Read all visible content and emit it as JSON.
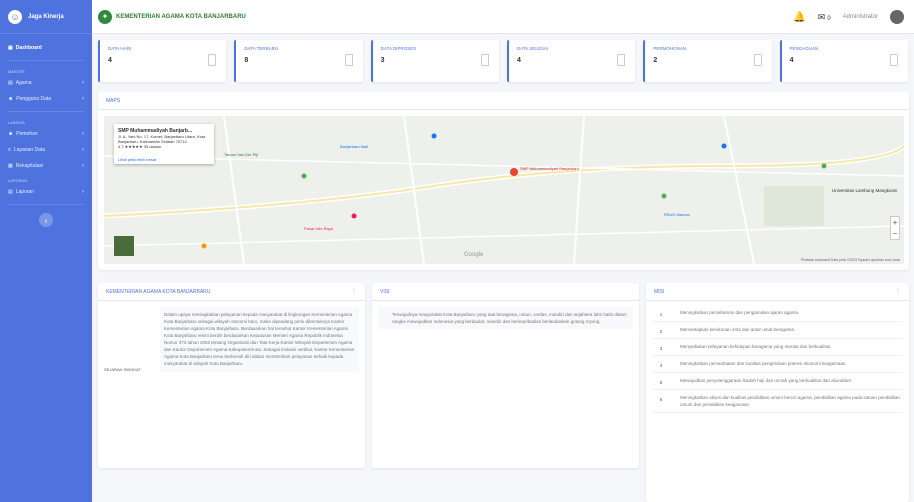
{
  "sidebar": {
    "brand": "Jaga Kinerja",
    "dashboard": "Dashboard",
    "head1": "Master",
    "item_agama": "Agama",
    "item_pengguna": "Pengguna Data",
    "head2": "Lainnya",
    "item_pemohon": "Pemohon",
    "item_layanan": "Layanan Data",
    "item_rekap": "Rekapitulasi",
    "head3": "Laporan",
    "item_laporan": "Laporan"
  },
  "topbar": {
    "title": "KEMENTERIAN AGAMA KOTA BANJARBARU",
    "mail_count": "0",
    "user": "Administrator"
  },
  "cards": [
    {
      "label": "DATA HARI",
      "value": "4"
    },
    {
      "label": "DATA TERBARU",
      "value": "8"
    },
    {
      "label": "DATA DIPROSES",
      "value": "3"
    },
    {
      "label": "DATA SELESAI",
      "value": "4"
    },
    {
      "label": "PERMOHONAN",
      "value": "2"
    },
    {
      "label": "PENGADUAN",
      "value": "4"
    }
  ],
  "map": {
    "heading": "MAPS",
    "info_name": "SMP Muhammadiyah Banjarb...",
    "info_addr": "Jl. A. Yani No. 17, Komet, Banjarbaru Utara, Kota Banjarbaru, Kalimantan Selatan 70714",
    "info_rating": "4.7 ★★★★★ 35 ulasan",
    "info_link": "Lihat peta lebih besar",
    "footer": "Pintasan keyboard  Data peta ©2023  Syarat  Laporkan error peta",
    "google": "Google",
    "places": [
      {
        "label": "SMP Muhammadiyah Banjarbaru"
      },
      {
        "label": "Banjarbaru Mall"
      },
      {
        "label": "Universitas Lambung Mangkurat"
      },
      {
        "label": "Taman Van Der Pijl"
      },
      {
        "label": "RSUD Idaman"
      },
      {
        "label": "Pasar Ulin Raya"
      }
    ]
  },
  "profil": {
    "heading": "KEMENTERIAN AGAMA KOTA BANJARBARU",
    "label": "SEJARAH SINGKAT",
    "text": "Dalam upaya meningkatkan pelayanan kepada masyarakat di lingkungan Kementerian Agama Kota Banjarbaru sebagai wilayah otonomi baru, maka dipandang perlu dibentuknya Kantor Kementerian Agama Kota Banjarbaru. Berdasarkan hal tersebut Kantor Kementerian Agama Kota Banjarbaru resmi berdiri berdasarkan Keputusan Menteri Agama Republik Indonesia Nomor 373 tahun 2002 tentang Organisasi dan Tata Kerja Kantor Wilayah Departemen Agama dan Kantor Departemen Agama Kabupaten/Kota. Sebagai instansi vertikal, Kantor Kementerian Agama Kota Banjarbaru terus berbenah diri dalam memberikan pelayanan terbaik kepada masyarakat di wilayah Kota Banjarbaru."
  },
  "visi": {
    "heading": "VISI",
    "text": "Terwujudnya masyarakat Kota Banjarbaru yang taat beragama, rukun, cerdas, mandiri dan sejahtera lahir batin dalam rangka mewujudkan Indonesia yang berdaulat, mandiri dan berkepribadian berlandaskan gotong royong."
  },
  "misi": {
    "heading": "MISI",
    "items": [
      {
        "n": "1",
        "text": "Meningkatkan pemahaman dan pengamalan ajaran agama."
      },
      {
        "n": "2",
        "text": "Memantapkan kerukunan intra dan antar umat beragama."
      },
      {
        "n": "3",
        "text": "Menyediakan pelayanan kehidupan beragama yang merata dan berkualitas."
      },
      {
        "n": "4",
        "text": "Meningkatkan pemanfaatan dan kualitas pengelolaan potensi ekonomi keagamaan."
      },
      {
        "n": "5",
        "text": "Mewujudkan penyelenggaraan ibadah haji dan umrah yang berkualitas dan akuntabel."
      },
      {
        "n": "6",
        "text": "Meningkatkan akses dan kualitas pendidikan umum berciri agama, pendidikan agama pada satuan pendidikan umum dan pendidikan keagamaan."
      }
    ]
  }
}
